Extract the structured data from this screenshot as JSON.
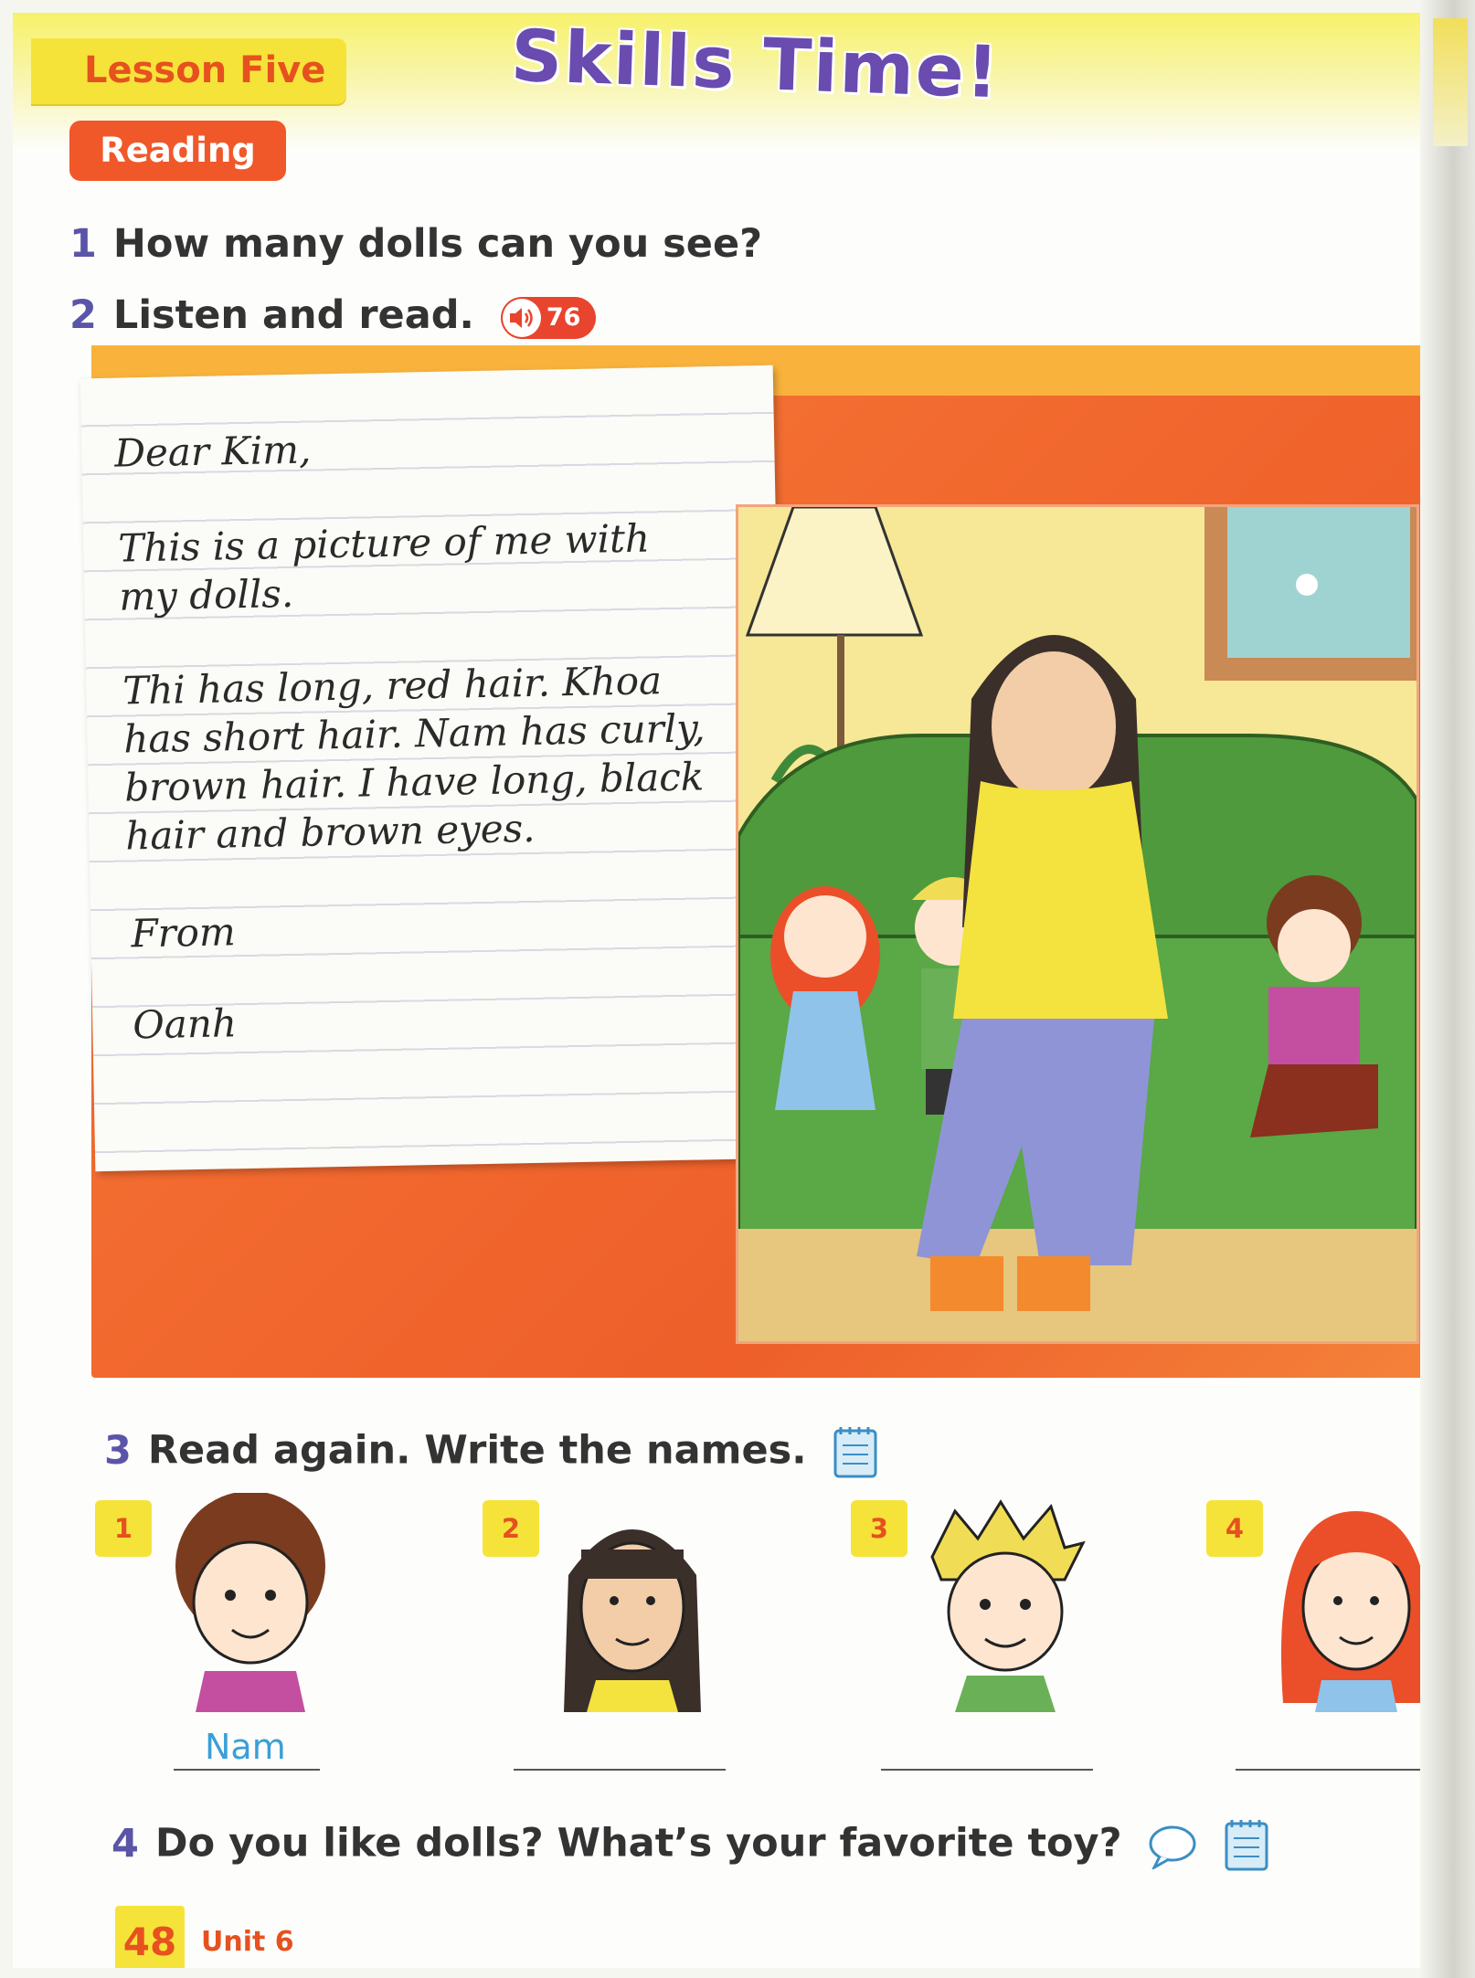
{
  "header": {
    "lesson_label": "Lesson Five",
    "title": "Skills Time!",
    "section_badge": "Reading"
  },
  "exercises": {
    "ex1": {
      "number": "1",
      "text": "How many dolls can you see?"
    },
    "ex2": {
      "number": "2",
      "text": "Listen and read.",
      "audio_track": "76"
    },
    "ex3": {
      "number": "3",
      "text": "Read again. Write the names."
    },
    "ex4": {
      "number": "4",
      "text": "Do you like dolls? What’s your favorite toy?"
    }
  },
  "letter": {
    "greeting": "Dear Kim,",
    "para1_line1": "This is a picture of me with",
    "para1_line2": "my dolls.",
    "para2_line1": "Thi has long, red hair. Khoa",
    "para2_line2": "has short hair. Nam has curly,",
    "para2_line3": "brown hair. I have long, black",
    "para2_line4": "hair and brown eyes.",
    "closing": "From",
    "signature": "Oanh"
  },
  "name_tasks": [
    {
      "number": "1",
      "answer": "Nam"
    },
    {
      "number": "2",
      "answer": ""
    },
    {
      "number": "3",
      "answer": ""
    },
    {
      "number": "4",
      "answer": ""
    }
  ],
  "footer": {
    "page_number": "48",
    "unit": "Unit 6"
  },
  "colors": {
    "accent_orange": "#f0582a",
    "accent_yellow": "#f6e33a",
    "title_purple": "#6a4bb0",
    "answer_blue": "#3a9fd8"
  },
  "icons": [
    "speaker-icon",
    "notebook-icon",
    "speech-bubble-icon"
  ]
}
